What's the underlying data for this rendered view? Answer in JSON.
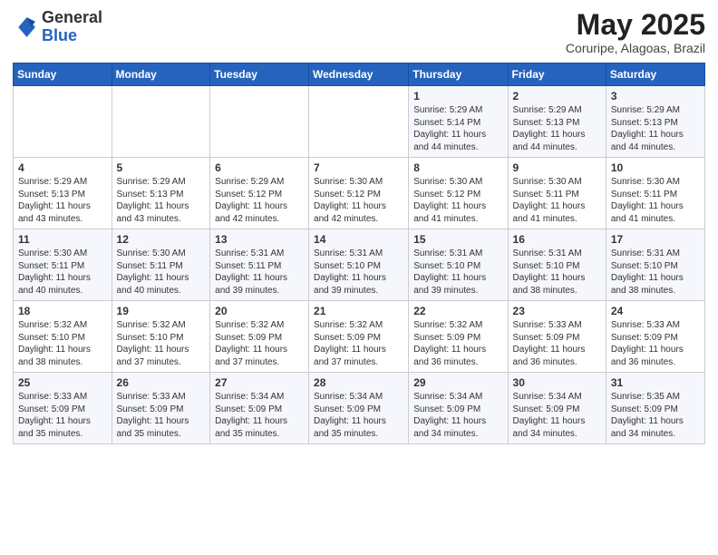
{
  "header": {
    "logo_general": "General",
    "logo_blue": "Blue",
    "month_title": "May 2025",
    "location": "Coruripe, Alagoas, Brazil"
  },
  "days_of_week": [
    "Sunday",
    "Monday",
    "Tuesday",
    "Wednesday",
    "Thursday",
    "Friday",
    "Saturday"
  ],
  "weeks": [
    [
      {
        "day": "",
        "content": ""
      },
      {
        "day": "",
        "content": ""
      },
      {
        "day": "",
        "content": ""
      },
      {
        "day": "",
        "content": ""
      },
      {
        "day": "1",
        "content": "Sunrise: 5:29 AM\nSunset: 5:14 PM\nDaylight: 11 hours\nand 44 minutes."
      },
      {
        "day": "2",
        "content": "Sunrise: 5:29 AM\nSunset: 5:13 PM\nDaylight: 11 hours\nand 44 minutes."
      },
      {
        "day": "3",
        "content": "Sunrise: 5:29 AM\nSunset: 5:13 PM\nDaylight: 11 hours\nand 44 minutes."
      }
    ],
    [
      {
        "day": "4",
        "content": "Sunrise: 5:29 AM\nSunset: 5:13 PM\nDaylight: 11 hours\nand 43 minutes."
      },
      {
        "day": "5",
        "content": "Sunrise: 5:29 AM\nSunset: 5:13 PM\nDaylight: 11 hours\nand 43 minutes."
      },
      {
        "day": "6",
        "content": "Sunrise: 5:29 AM\nSunset: 5:12 PM\nDaylight: 11 hours\nand 42 minutes."
      },
      {
        "day": "7",
        "content": "Sunrise: 5:30 AM\nSunset: 5:12 PM\nDaylight: 11 hours\nand 42 minutes."
      },
      {
        "day": "8",
        "content": "Sunrise: 5:30 AM\nSunset: 5:12 PM\nDaylight: 11 hours\nand 41 minutes."
      },
      {
        "day": "9",
        "content": "Sunrise: 5:30 AM\nSunset: 5:11 PM\nDaylight: 11 hours\nand 41 minutes."
      },
      {
        "day": "10",
        "content": "Sunrise: 5:30 AM\nSunset: 5:11 PM\nDaylight: 11 hours\nand 41 minutes."
      }
    ],
    [
      {
        "day": "11",
        "content": "Sunrise: 5:30 AM\nSunset: 5:11 PM\nDaylight: 11 hours\nand 40 minutes."
      },
      {
        "day": "12",
        "content": "Sunrise: 5:30 AM\nSunset: 5:11 PM\nDaylight: 11 hours\nand 40 minutes."
      },
      {
        "day": "13",
        "content": "Sunrise: 5:31 AM\nSunset: 5:11 PM\nDaylight: 11 hours\nand 39 minutes."
      },
      {
        "day": "14",
        "content": "Sunrise: 5:31 AM\nSunset: 5:10 PM\nDaylight: 11 hours\nand 39 minutes."
      },
      {
        "day": "15",
        "content": "Sunrise: 5:31 AM\nSunset: 5:10 PM\nDaylight: 11 hours\nand 39 minutes."
      },
      {
        "day": "16",
        "content": "Sunrise: 5:31 AM\nSunset: 5:10 PM\nDaylight: 11 hours\nand 38 minutes."
      },
      {
        "day": "17",
        "content": "Sunrise: 5:31 AM\nSunset: 5:10 PM\nDaylight: 11 hours\nand 38 minutes."
      }
    ],
    [
      {
        "day": "18",
        "content": "Sunrise: 5:32 AM\nSunset: 5:10 PM\nDaylight: 11 hours\nand 38 minutes."
      },
      {
        "day": "19",
        "content": "Sunrise: 5:32 AM\nSunset: 5:10 PM\nDaylight: 11 hours\nand 37 minutes."
      },
      {
        "day": "20",
        "content": "Sunrise: 5:32 AM\nSunset: 5:09 PM\nDaylight: 11 hours\nand 37 minutes."
      },
      {
        "day": "21",
        "content": "Sunrise: 5:32 AM\nSunset: 5:09 PM\nDaylight: 11 hours\nand 37 minutes."
      },
      {
        "day": "22",
        "content": "Sunrise: 5:32 AM\nSunset: 5:09 PM\nDaylight: 11 hours\nand 36 minutes."
      },
      {
        "day": "23",
        "content": "Sunrise: 5:33 AM\nSunset: 5:09 PM\nDaylight: 11 hours\nand 36 minutes."
      },
      {
        "day": "24",
        "content": "Sunrise: 5:33 AM\nSunset: 5:09 PM\nDaylight: 11 hours\nand 36 minutes."
      }
    ],
    [
      {
        "day": "25",
        "content": "Sunrise: 5:33 AM\nSunset: 5:09 PM\nDaylight: 11 hours\nand 35 minutes."
      },
      {
        "day": "26",
        "content": "Sunrise: 5:33 AM\nSunset: 5:09 PM\nDaylight: 11 hours\nand 35 minutes."
      },
      {
        "day": "27",
        "content": "Sunrise: 5:34 AM\nSunset: 5:09 PM\nDaylight: 11 hours\nand 35 minutes."
      },
      {
        "day": "28",
        "content": "Sunrise: 5:34 AM\nSunset: 5:09 PM\nDaylight: 11 hours\nand 35 minutes."
      },
      {
        "day": "29",
        "content": "Sunrise: 5:34 AM\nSunset: 5:09 PM\nDaylight: 11 hours\nand 34 minutes."
      },
      {
        "day": "30",
        "content": "Sunrise: 5:34 AM\nSunset: 5:09 PM\nDaylight: 11 hours\nand 34 minutes."
      },
      {
        "day": "31",
        "content": "Sunrise: 5:35 AM\nSunset: 5:09 PM\nDaylight: 11 hours\nand 34 minutes."
      }
    ]
  ]
}
